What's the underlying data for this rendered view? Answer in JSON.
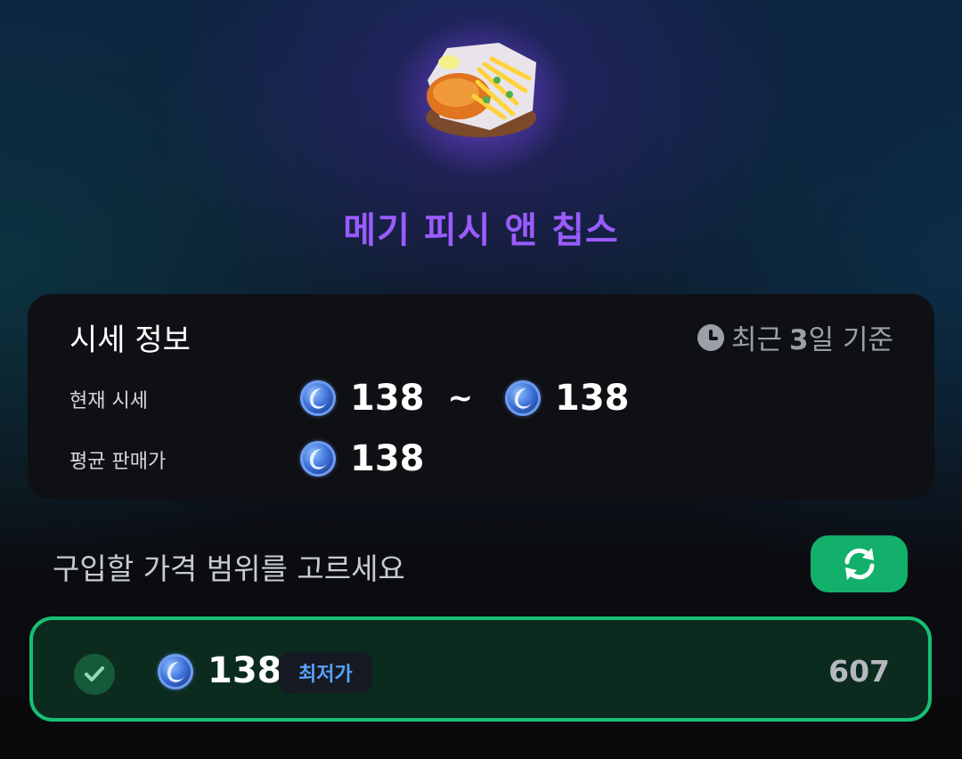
{
  "item": {
    "name": "메기 피시 앤 칩스",
    "image_icon": "fish-and-chips-icon",
    "title_color": "#9a5cff"
  },
  "price_info": {
    "title": "시세 정보",
    "basis_prefix": "최근",
    "basis_days": "3",
    "basis_suffix": "일 기준",
    "current_label": "현재 시세",
    "current_min": "138",
    "range_separator": "~",
    "current_max": "138",
    "average_label": "평균 판매가",
    "average_value": "138",
    "currency_icon": "moon-coin-icon"
  },
  "selection": {
    "prompt": "구입할 가격 범위를 고르세요",
    "refresh_icon": "refresh-icon",
    "accent_color": "#12b06b",
    "options": [
      {
        "price": "138",
        "badge": "최저가",
        "quantity": "607",
        "selected": true
      }
    ]
  }
}
